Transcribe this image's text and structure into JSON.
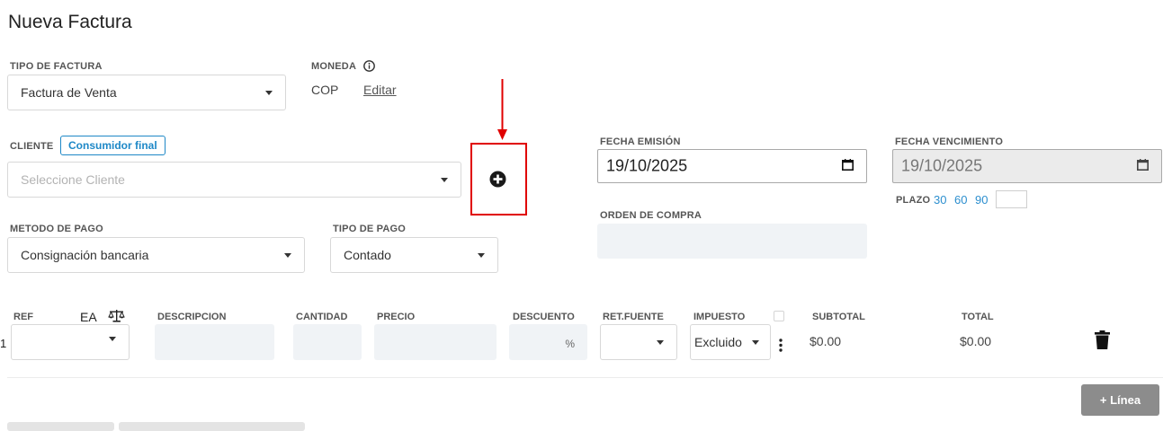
{
  "page": {
    "title": "Nueva Factura"
  },
  "invoice_type": {
    "label": "TIPO DE FACTURA",
    "value": "Factura de Venta"
  },
  "currency": {
    "label": "MONEDA",
    "value": "COP",
    "edit_label": "Editar"
  },
  "client": {
    "label": "CLIENTE",
    "badge": "Consumidor final",
    "placeholder": "Seleccione Cliente"
  },
  "payment_method": {
    "label": "METODO DE PAGO",
    "value": "Consignación bancaria"
  },
  "payment_type": {
    "label": "TIPO DE PAGO",
    "value": "Contado"
  },
  "issue_date": {
    "label": "FECHA EMISIÓN",
    "value": "19/10/2025"
  },
  "due_date": {
    "label": "FECHA VENCIMIENTO",
    "value": "19/10/2025"
  },
  "term": {
    "label": "PLAZO",
    "options": [
      "30",
      "60",
      "90"
    ]
  },
  "purchase_order": {
    "label": "ORDEN DE COMPRA"
  },
  "lines": {
    "headers": {
      "ref": "REF",
      "unit": "EA",
      "description": "DESCRIPCION",
      "quantity": "CANTIDAD",
      "price": "PRECIO",
      "discount": "DESCUENTO",
      "withholding": "RET.FUENTE",
      "tax": "IMPUESTO",
      "subtotal": "SUBTOTAL",
      "total": "TOTAL"
    },
    "row": {
      "number": "1",
      "discount_suffix": "%",
      "tax_value": "Excluido",
      "subtotal": "$0.00",
      "total": "$0.00"
    },
    "add_line_label": "+ Línea"
  },
  "colors": {
    "accent": "#2d8fcf",
    "annotation": "#e00000",
    "add_button": "#8c8c8c"
  }
}
